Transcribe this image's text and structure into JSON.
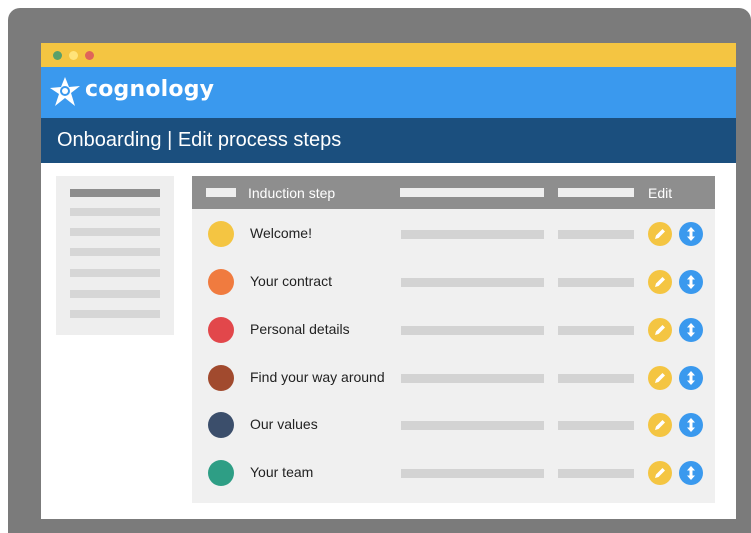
{
  "brand": {
    "name": "cognology"
  },
  "page": {
    "title": "Onboarding | Edit process steps"
  },
  "table": {
    "headers": {
      "step": "Induction step",
      "edit": "Edit"
    },
    "rows": [
      {
        "label": "Welcome!",
        "color": "#f4c542"
      },
      {
        "label": "Your contract",
        "color": "#f07b3f"
      },
      {
        "label": "Personal details",
        "color": "#e2474b"
      },
      {
        "label": "Find your way around",
        "color": "#a14a2e"
      },
      {
        "label": "Our values",
        "color": "#3b4e6b"
      },
      {
        "label": "Your team",
        "color": "#2e9e85"
      }
    ]
  },
  "icons": {
    "edit": "pencil-icon",
    "move": "up-down-arrows-icon",
    "logo": "cognology-star-icon"
  },
  "colors": {
    "titlebar": "#f4c542",
    "brand_bar": "#3a99ee",
    "page_bar": "#1b4f7e",
    "edit_button": "#f4c542",
    "move_button": "#3a99ee"
  }
}
